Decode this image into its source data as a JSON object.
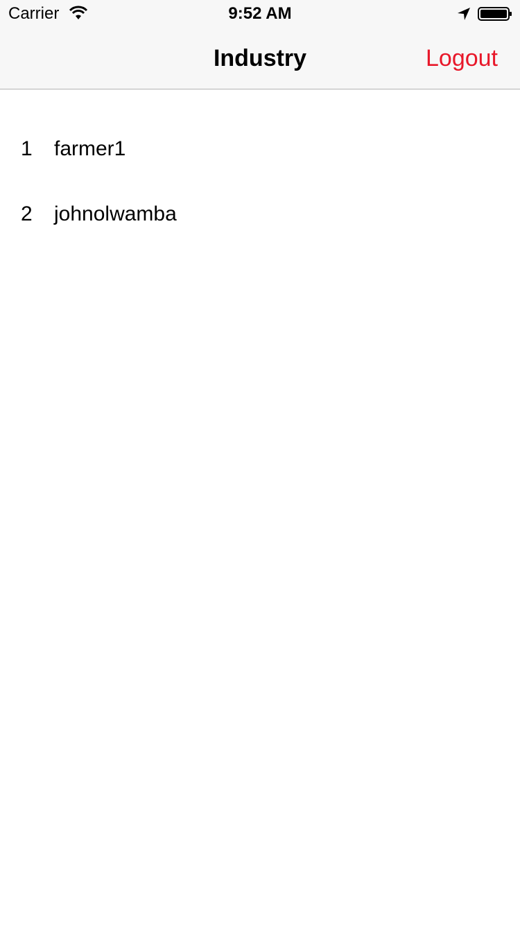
{
  "status_bar": {
    "carrier": "Carrier",
    "time": "9:52 AM",
    "icons": [
      "wifi-icon",
      "location-arrow-icon",
      "battery-icon"
    ]
  },
  "nav_bar": {
    "title": "Industry",
    "logout_label": "Logout",
    "accent_color": "#e8182a"
  },
  "list": {
    "items": [
      {
        "index": "1",
        "name": "farmer1"
      },
      {
        "index": "2",
        "name": "johnolwamba"
      }
    ]
  }
}
